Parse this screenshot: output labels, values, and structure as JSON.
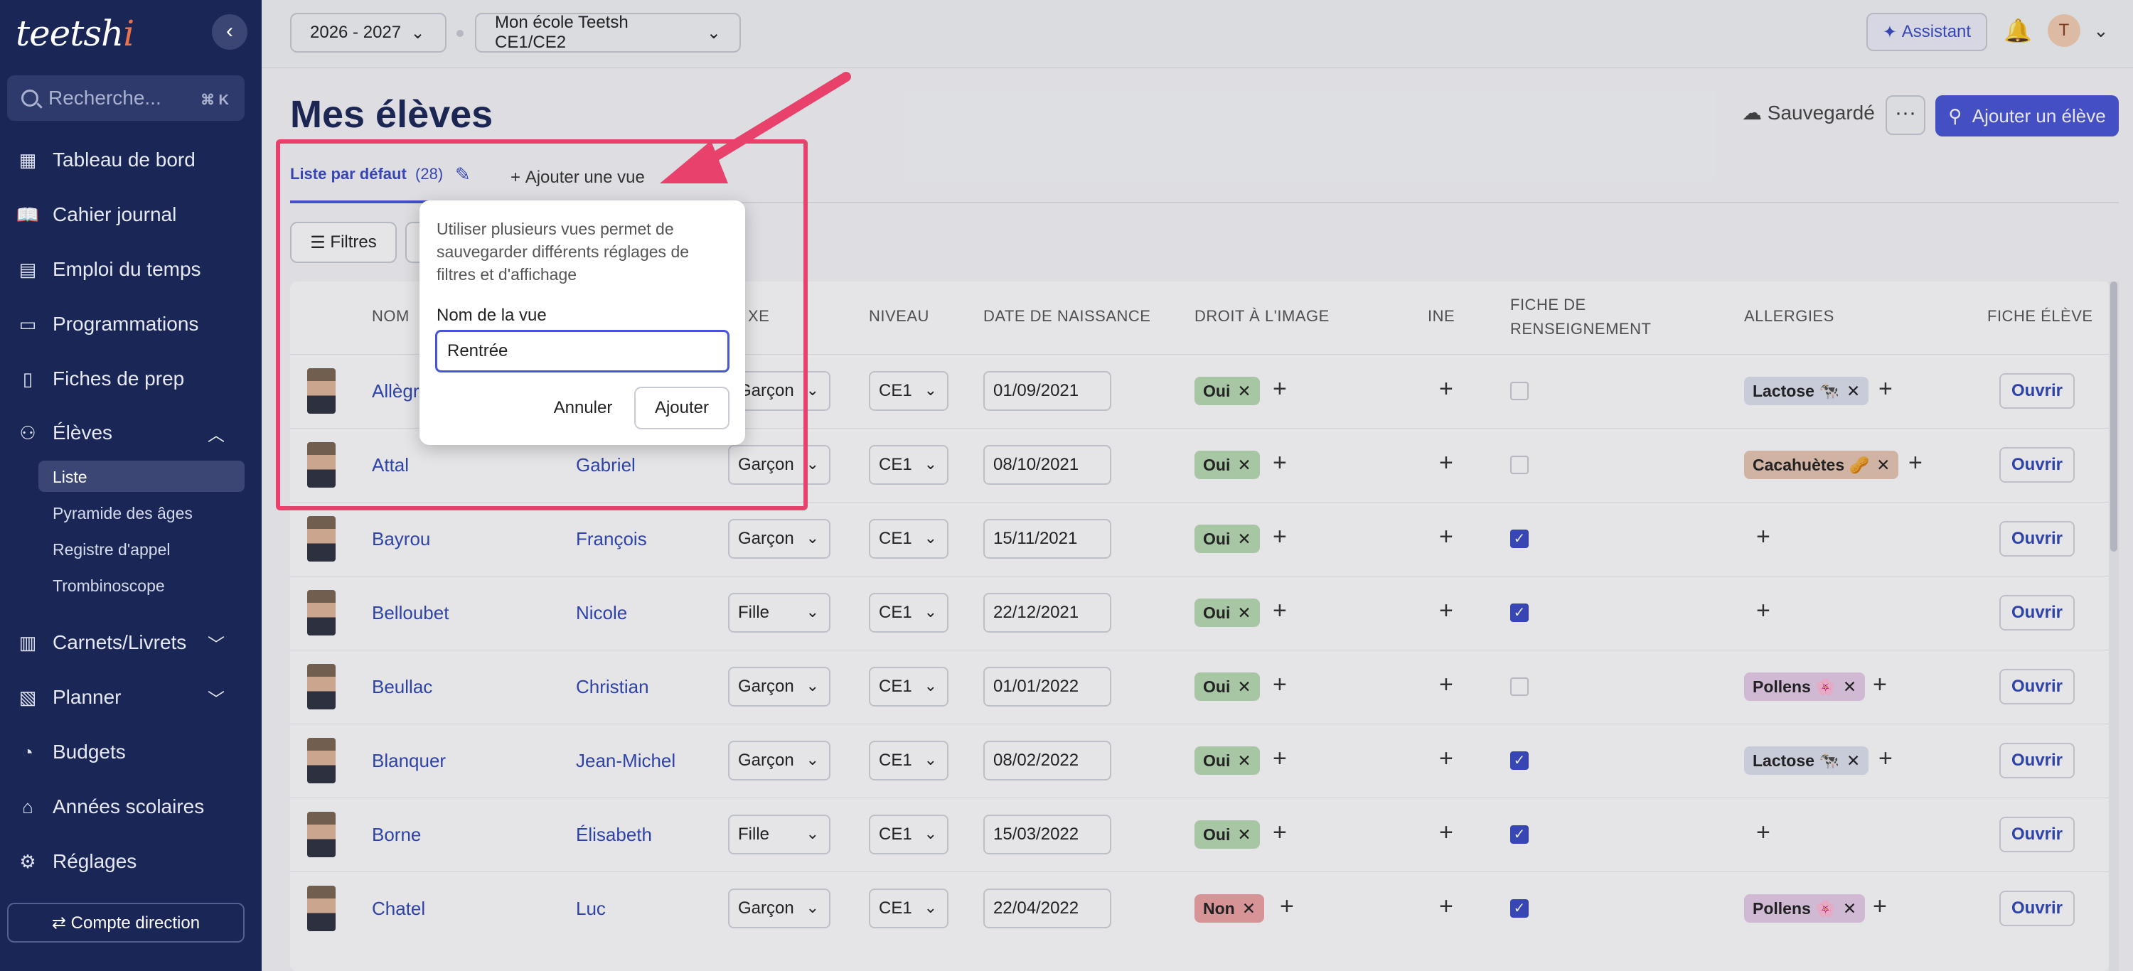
{
  "sidebar": {
    "logo": {
      "main": "teetsh",
      "accent": "i"
    },
    "search": {
      "placeholder": "Recherche...",
      "shortcut": "⌘ K"
    },
    "items": [
      {
        "label": "Tableau de bord",
        "icon": "dashboard-icon"
      },
      {
        "label": "Cahier journal",
        "icon": "book-icon"
      },
      {
        "label": "Emploi du temps",
        "icon": "calendar-icon"
      },
      {
        "label": "Programmations",
        "icon": "program-icon"
      },
      {
        "label": "Fiches de prep",
        "icon": "file-icon"
      },
      {
        "label": "Élèves",
        "icon": "students-icon"
      },
      {
        "label": "Carnets/Livrets",
        "icon": "notebook-icon"
      },
      {
        "label": "Planner",
        "icon": "planner-icon"
      },
      {
        "label": "Budgets",
        "icon": "piggy-bank-icon"
      },
      {
        "label": "Années scolaires",
        "icon": "school-icon"
      },
      {
        "label": "Réglages",
        "icon": "gear-icon"
      }
    ],
    "eleves_sub": [
      "Liste",
      "Pyramide des âges",
      "Registre d'appel",
      "Trombinoscope"
    ],
    "compte": "⇄ Compte direction"
  },
  "topbar": {
    "year": "2026 - 2027",
    "school": "Mon école Teetsh CE1/CE2",
    "assistant": "Assistant",
    "avatar_initial": "T"
  },
  "main": {
    "title": "Mes élèves",
    "saved": "Sauvegardé",
    "more": "···",
    "add_student": "Ajouter un élève",
    "tab_default": "Liste par défaut",
    "tab_count": "(28)",
    "add_view": "Ajouter une vue",
    "filters": "Filtres"
  },
  "popover": {
    "help": "Utiliser plusieurs vues permet de sauvegarder différents réglages de filtres et d'affichage",
    "label": "Nom de la vue",
    "value": "Rentrée",
    "cancel": "Annuler",
    "add": "Ajouter"
  },
  "table": {
    "headers": [
      "NOM",
      "XE",
      "NIVEAU",
      "DATE DE NAISSANCE",
      "DROIT À L'IMAGE",
      "INE",
      "FICHE DE",
      "RENSEIGNEMENT",
      "ALLERGIES",
      "FICHE ÉLÈVE"
    ],
    "open_label": "Ouvrir",
    "rows": [
      {
        "nom": "Allègr",
        "prenom": "",
        "sexe": "Garçon",
        "niveau": "CE1",
        "date": "01/09/2021",
        "image": "Oui",
        "fiche": false,
        "allergy": "Lactose 🐄"
      },
      {
        "nom": "Attal",
        "prenom": "Gabriel",
        "sexe": "Garçon",
        "niveau": "CE1",
        "date": "08/10/2021",
        "image": "Oui",
        "fiche": false,
        "allergy": "Cacahuètes 🥜"
      },
      {
        "nom": "Bayrou",
        "prenom": "François",
        "sexe": "Garçon",
        "niveau": "CE1",
        "date": "15/11/2021",
        "image": "Oui",
        "fiche": true,
        "allergy": ""
      },
      {
        "nom": "Belloubet",
        "prenom": "Nicole",
        "sexe": "Fille",
        "niveau": "CE1",
        "date": "22/12/2021",
        "image": "Oui",
        "fiche": true,
        "allergy": ""
      },
      {
        "nom": "Beullac",
        "prenom": "Christian",
        "sexe": "Garçon",
        "niveau": "CE1",
        "date": "01/01/2022",
        "image": "Oui",
        "fiche": false,
        "allergy": "Pollens 🌸"
      },
      {
        "nom": "Blanquer",
        "prenom": "Jean-Michel",
        "sexe": "Garçon",
        "niveau": "CE1",
        "date": "08/02/2022",
        "image": "Oui",
        "fiche": true,
        "allergy": "Lactose 🐄"
      },
      {
        "nom": "Borne",
        "prenom": "Élisabeth",
        "sexe": "Fille",
        "niveau": "CE1",
        "date": "15/03/2022",
        "image": "Oui",
        "fiche": true,
        "allergy": ""
      },
      {
        "nom": "Chatel",
        "prenom": "Luc",
        "sexe": "Garçon",
        "niveau": "CE1",
        "date": "22/04/2022",
        "image": "Non",
        "fiche": true,
        "allergy": "Pollens 🌸"
      }
    ]
  },
  "colors": {
    "sidebar": "#1a2656",
    "accent": "#4755d6",
    "highlight": "#e8416b",
    "tag_yes": "#b9dcb2",
    "tag_no": "#f0a3a3",
    "allergy_lactose": "#dfe3ef",
    "allergy_peanut": "#e7c7b2",
    "allergy_pollen": "#e8cde9"
  }
}
